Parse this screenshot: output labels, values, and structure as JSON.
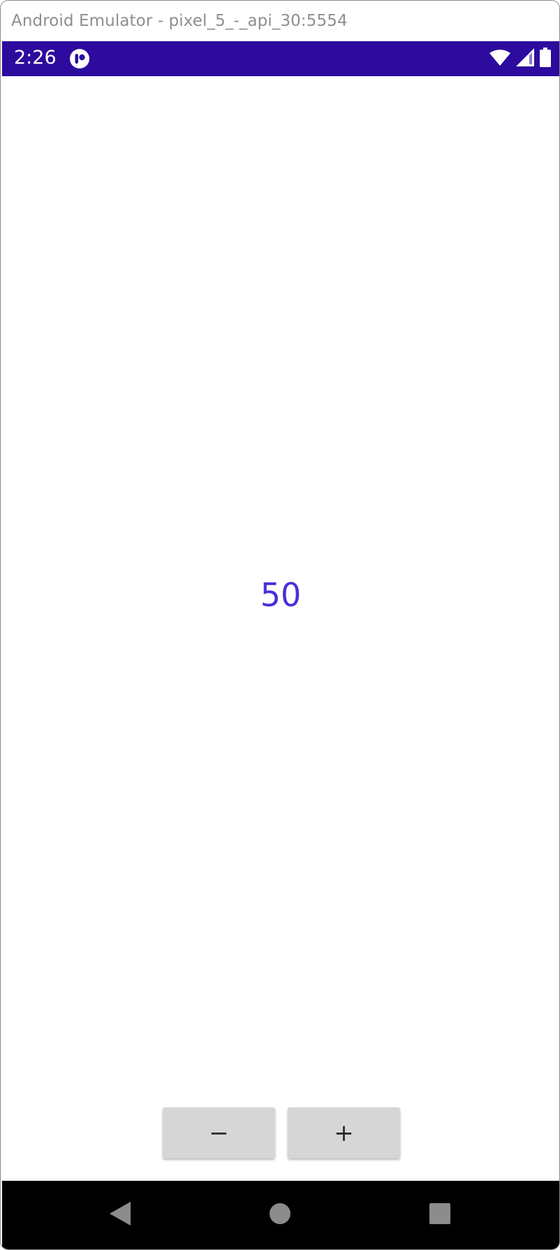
{
  "window": {
    "title": "Android Emulator - pixel_5_-_api_30:5554"
  },
  "status_bar": {
    "time": "2:26",
    "background_color": "#2c0b9e",
    "icons": [
      "app-notification-icon",
      "wifi-icon",
      "cellular-signal-icon",
      "battery-icon"
    ]
  },
  "main": {
    "counter_value": "50",
    "counter_color": "#4a2fd8",
    "decrement_label": "−",
    "increment_label": "+"
  },
  "nav_bar": {
    "buttons": [
      "back-icon",
      "home-icon",
      "recents-icon"
    ]
  }
}
